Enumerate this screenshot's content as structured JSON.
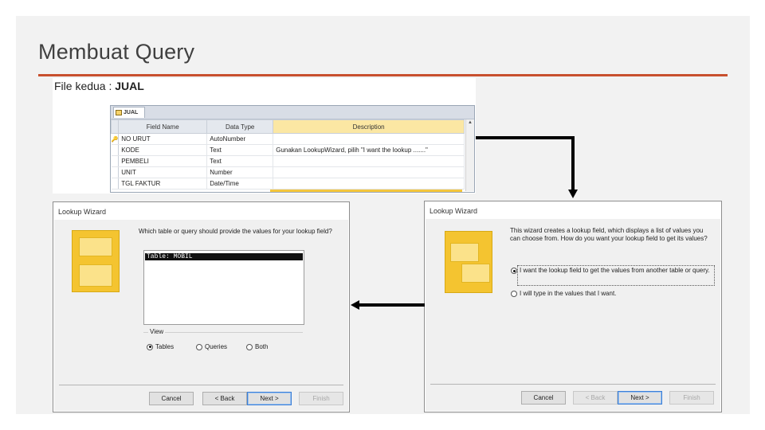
{
  "slide": {
    "title": "Membuat Query"
  },
  "top_shot": {
    "file_label_prefix": "File kedua : ",
    "file_label_table": "JUAL",
    "tab_name": "JUAL",
    "columns": [
      "Field Name",
      "Data Type",
      "Description"
    ],
    "rows": [
      {
        "field": "NO URUT",
        "type": "AutoNumber",
        "desc": ""
      },
      {
        "field": "KODE",
        "type": "Text",
        "desc": "Gunakan LookupWizard, pilih \"I want the lookup .......\""
      },
      {
        "field": "PEMBELI",
        "type": "Text",
        "desc": ""
      },
      {
        "field": "UNIT",
        "type": "Number",
        "desc": ""
      },
      {
        "field": "TGL FAKTUR",
        "type": "Date/Time",
        "desc": ""
      }
    ],
    "key_glyph": "🔑"
  },
  "wizard_left": {
    "title": "Lookup Wizard",
    "question": "Which table or query should provide the values for your lookup field?",
    "selected_item": "Table: MOBIL",
    "view_label": "View",
    "radios": [
      {
        "label": "Tables",
        "checked": true
      },
      {
        "label": "Queries",
        "checked": false
      },
      {
        "label": "Both",
        "checked": false
      }
    ],
    "buttons": {
      "cancel": "Cancel",
      "back": "< Back",
      "next": "Next >",
      "finish": "Finish"
    }
  },
  "wizard_right": {
    "title": "Lookup Wizard",
    "intro": "This wizard creates a lookup field, which displays a list of values you can choose from. How do you want your lookup field to get its values?",
    "options": [
      {
        "label": "I want the lookup field to get the values from another table or query.",
        "checked": true
      },
      {
        "label": "I will type in the values that I want.",
        "checked": false
      }
    ],
    "buttons": {
      "cancel": "Cancel",
      "back": "< Back",
      "next": "Next >",
      "finish": "Finish"
    }
  },
  "colors": {
    "accent_rule": "#c8502e",
    "wizard_art": "#f4c430",
    "description_header": "#fbe7a3"
  }
}
